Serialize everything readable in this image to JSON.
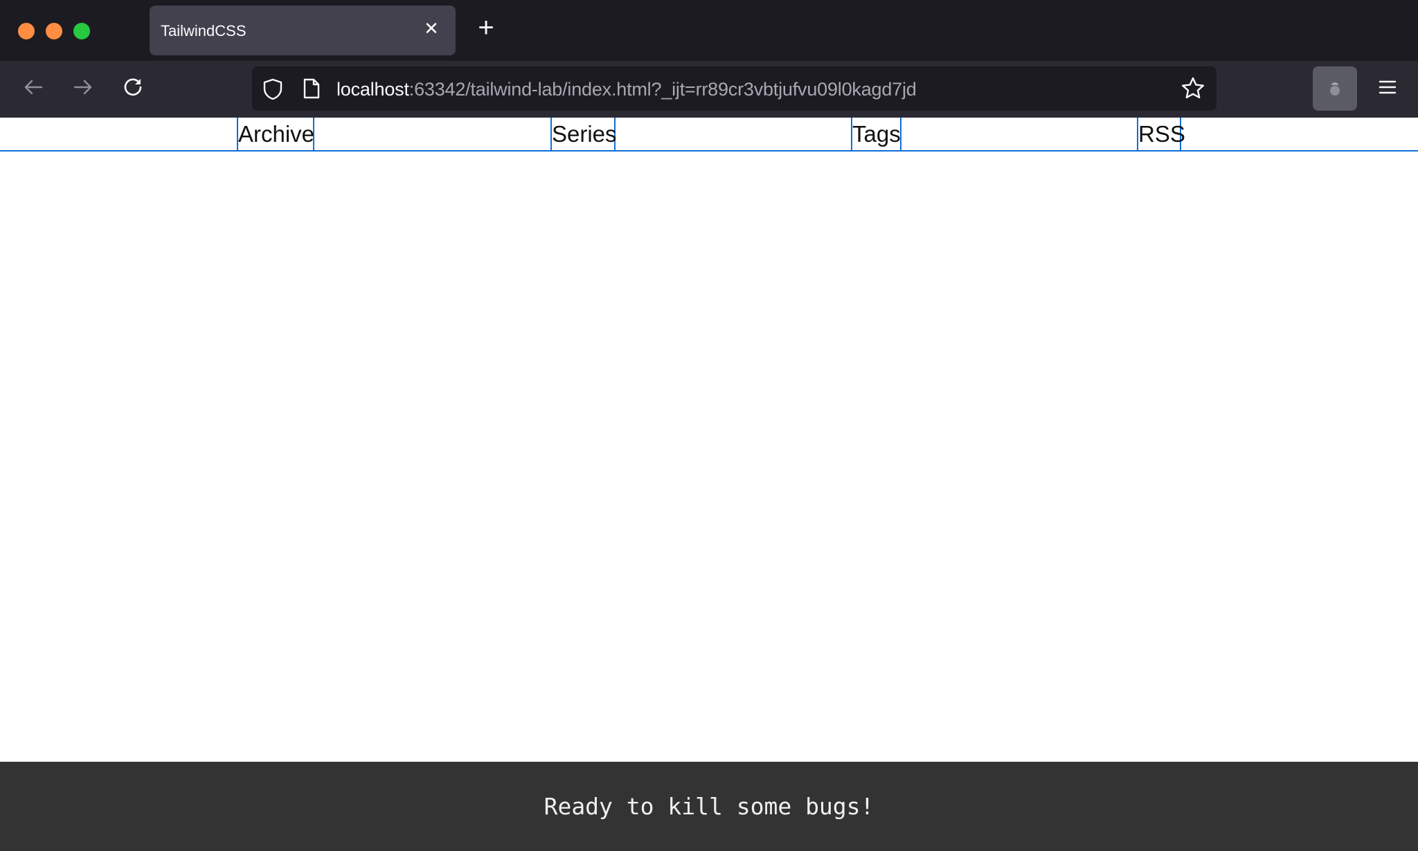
{
  "browser": {
    "tab": {
      "title": "TailwindCSS"
    },
    "url": {
      "host": "localhost",
      "rest": ":63342/tailwind-lab/index.html?_ijt=rr89cr3vbtjufvu09l0kagd7jd"
    },
    "icons": {
      "close_window": "traffic-light-close",
      "minimize_window": "traffic-light-minimize",
      "maximize_window": "traffic-light-maximize",
      "tab_close": "close-icon",
      "new_tab": "plus-icon",
      "back": "arrow-left-icon",
      "forward": "arrow-right-icon",
      "reload": "reload-icon",
      "tracking_protection": "shield-icon",
      "page_info": "page-icon",
      "bookmark": "star-icon",
      "extension": "extension-icon",
      "menu": "hamburger-menu-icon"
    },
    "tab_close_glyph": "✕",
    "new_tab_glyph": "+"
  },
  "site": {
    "nav": [
      {
        "label": "Archive"
      },
      {
        "label": "Series"
      },
      {
        "label": "Tags"
      },
      {
        "label": "RSS"
      }
    ],
    "nav_border_color": "#0f6fd8",
    "footer": {
      "text": "Ready to kill some bugs!",
      "background": "#333333"
    }
  }
}
